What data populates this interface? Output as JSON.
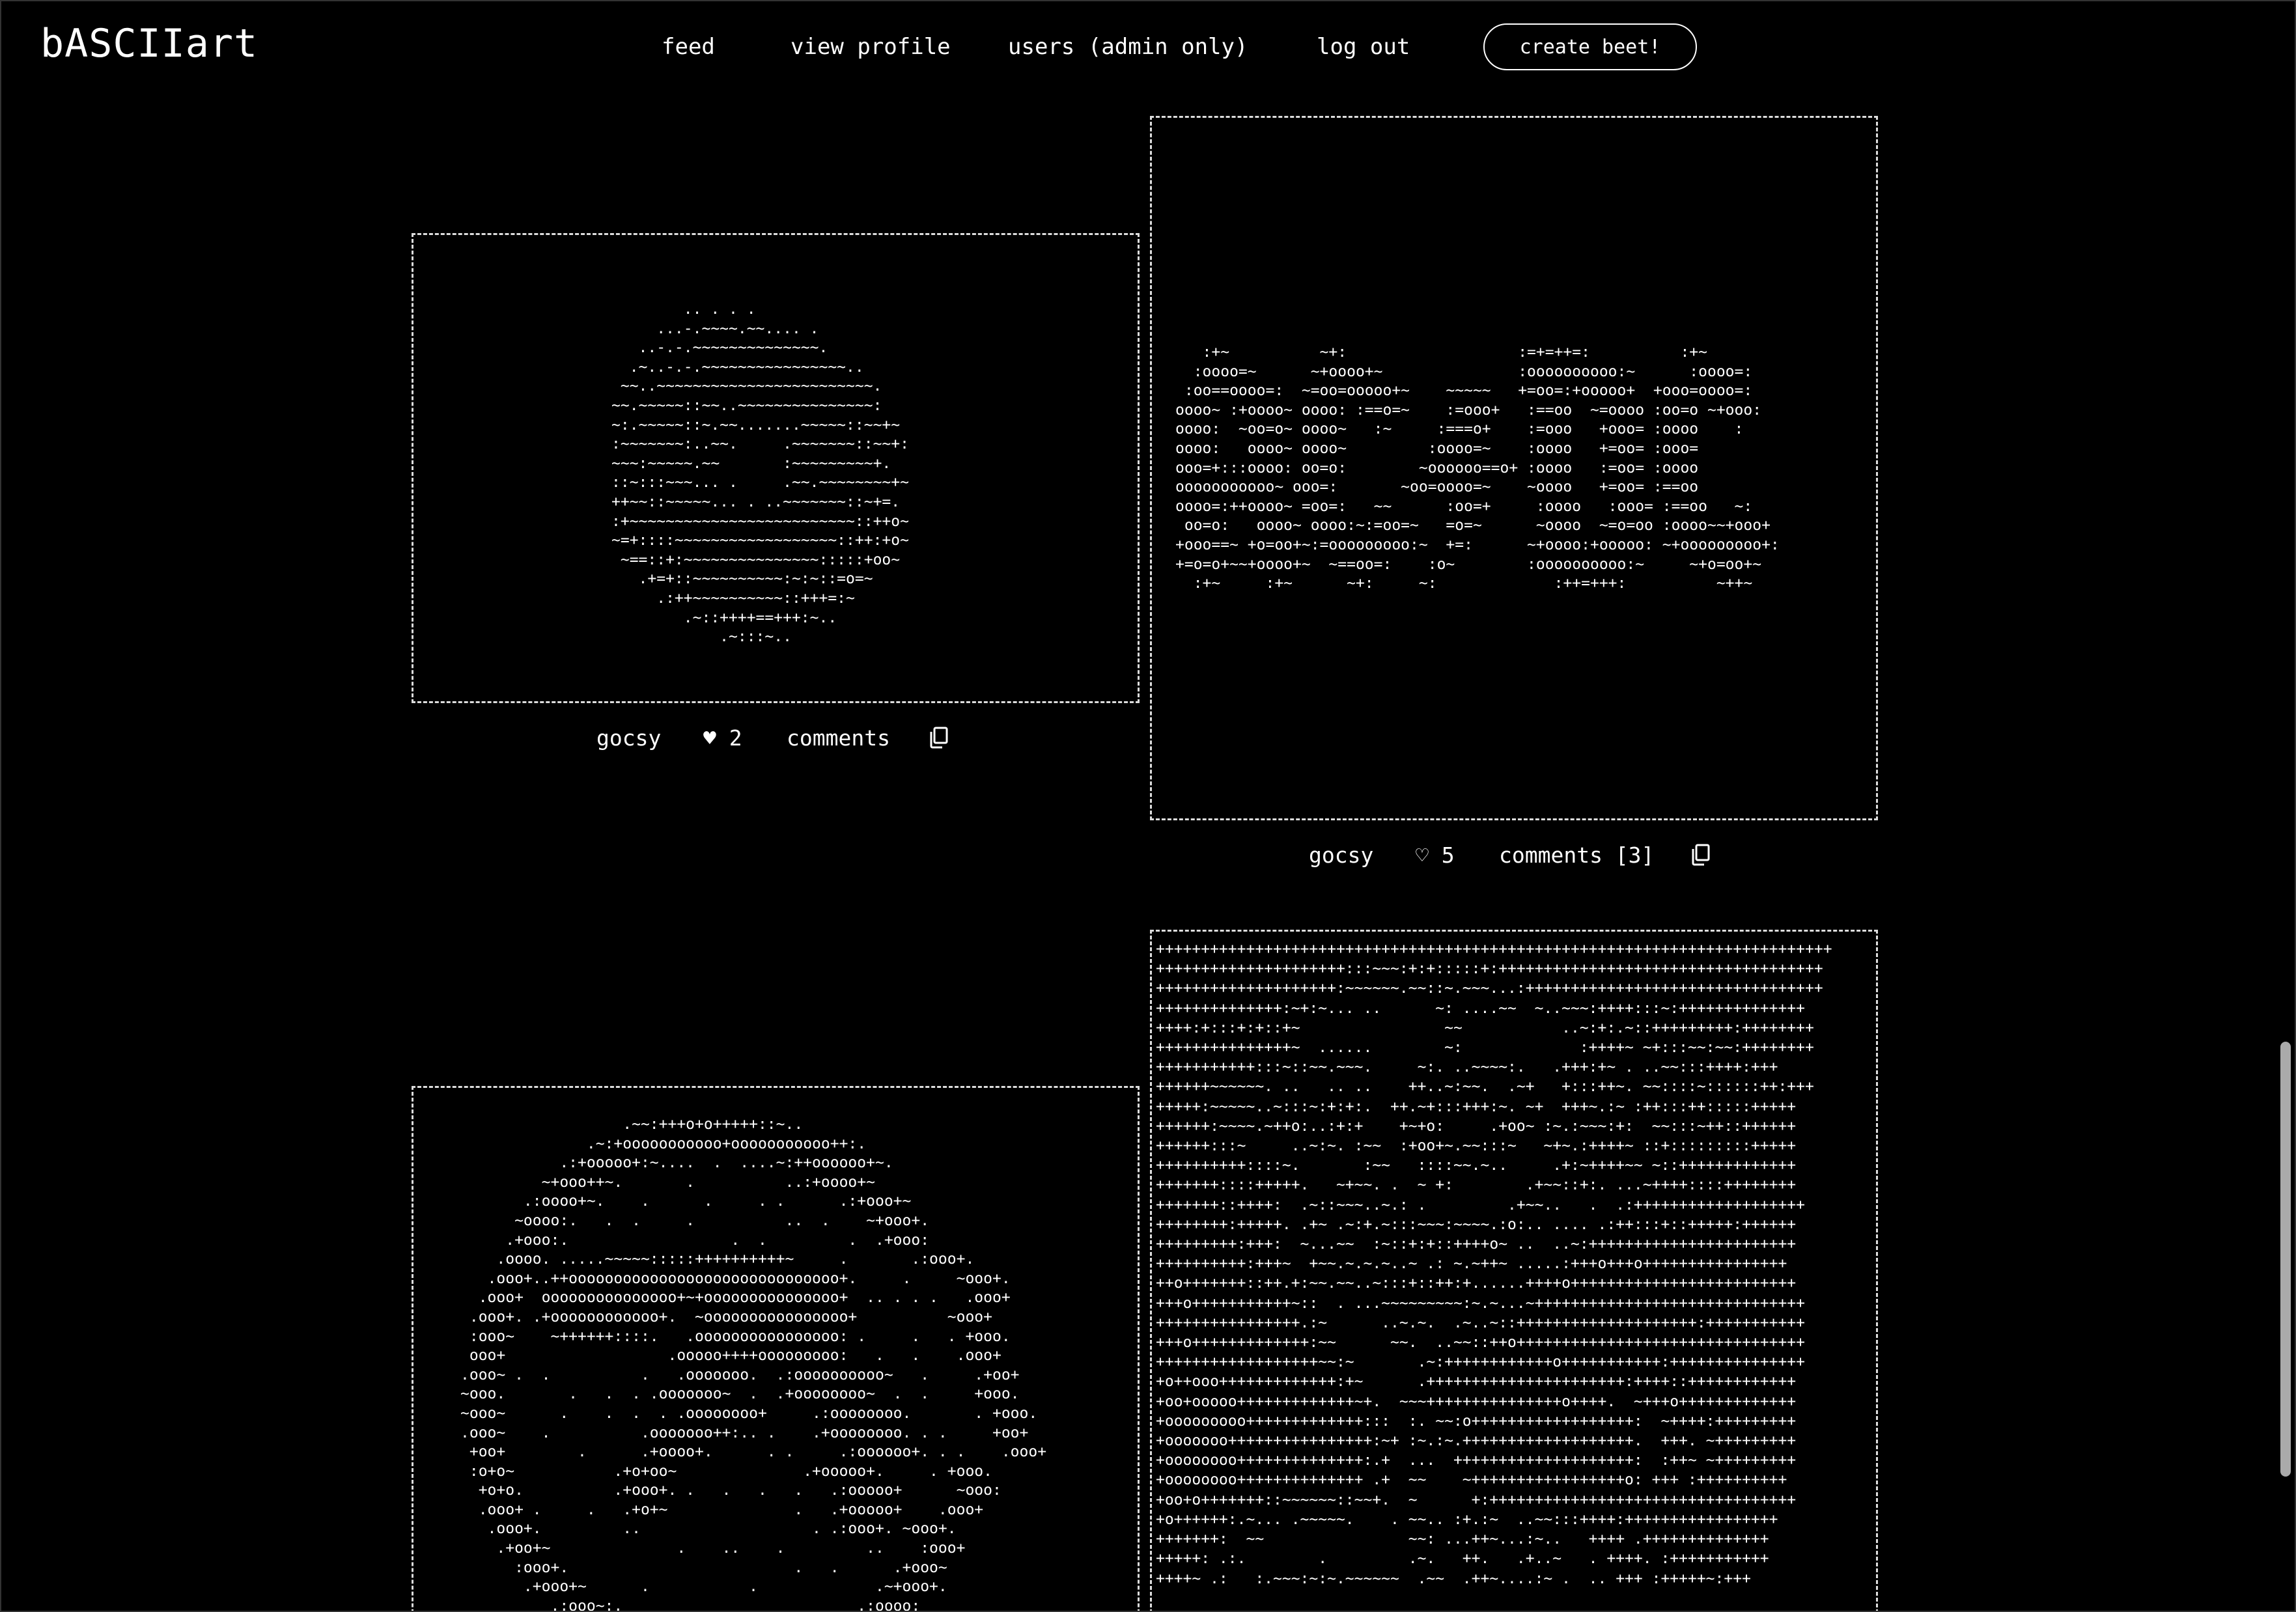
{
  "app": {
    "logo": "bASCIIart"
  },
  "nav": {
    "feed": "feed",
    "view_profile": "view profile",
    "users": "users (admin only)",
    "logout": "log out",
    "create": "create beet!"
  },
  "posts": [
    {
      "author": "gocsy",
      "likes": "♥ 2",
      "comments": "comments",
      "art": "        .. . . .\n     ...-.~~~~.~~.... .\n   ..-.-.~~~~~~~~~~~~~~.\n  .~..-.-.~~~~~~~~~~~~~~~~..\n ~~..~~~~~~~~~~~~~~~~~~~~~~~~.\n~~.~~~~~::~~..~~~~~~~~~~~~~~~:\n~:.~~~~~::~.~~.......~~~~~::~~+~\n:~~~~~~~:..~~.     .~~~~~~~::~~+:\n~~~:~~~~~.~~       :~~~~~~~~~+.\n::~:::~~~... .     .~~.~~~~~~~~+~\n++~~::~~~~~... . ..~~~~~~~::~+=.\n:+~~~~~~~~~~~~~~~~~~~~~~~~~::++o~\n~=+::::~~~~~~~~~~~~~~~~~~::++:+o~\n ~==::+:~~~~~~~~~~~~~~~:::::+oo~\n   .+=+::~~~~~~~~~~:~:~::=o=~\n     .:++~~~~~~~~~~::+++=:~\n        .~::++++==+++:~..\n            .~:::~.."
    },
    {
      "author": "gocsy",
      "likes": "♡ 5",
      "comments": "comments [3]",
      "art": "   :+~          ~+:                   :=+=++=:          :+~\n  :oooo=~      ~+oooo+~               :oooooooooo:~      :oooo=:\n :oo==oooo=:  ~=oo=ooooo+~    ~~~~~   +=oo=:+ooooo+  +ooo=oooo=:\noooo~ :+oooo~ oooo: :==o=~    :=ooo+   :==oo  ~=oooo :oo=o ~+ooo:\noooo:  ~oo=o~ oooo~   :~     :===o+    :=ooo   +ooo= :oooo    :\noooo:   oooo~ oooo~         :oooo=~    :oooo   +=oo= :ooo=\nooo=+:::oooo: oo=o:        ~oooooo==o+ :oooo   :=oo= :oooo\nooooooooooo~ ooo=:       ~oo=oooo=~    ~oooo   +=oo= :==oo\noooo=:++oooo~ =oo=:   ~~      :oo=+     :oooo   :ooo= :==oo   ~:\n oo=o:   oooo~ oooo:~:=oo=~   =o=~      ~oooo  ~=o=oo :oooo~~+ooo+\n+ooo==~ +o=oo+~:=ooooooooo:~  +=:      ~+oooo:+ooooo: ~+ooooooooo+:\n+=o=o+~~+oooo+~  ~==oo=:    :o~        :oooooooooo:~     ~+o=oo+~\n  :+~     :+~      ~+:     ~:             :++=+++:          ~++~"
    },
    {
      "author": "",
      "likes": "",
      "comments": "",
      "art": "                  .~~:+++o+o+++++::~..\n              .~:+ooooooooooo+ooooooooooo++:.\n           .:+ooooo+:~....  .  ....~:++oooooo+~.\n         ~+ooo++~.       .          ..:+oooo+~\n       .:oooo+~.    .      .     . .      .:+ooo+~\n      ~oooo:.   .  .     .          ..  .    ~+ooo+.\n     .+ooo:.                  .  .         .  .+ooo:\n    .oooo. .....~~~~~:::::++++++++++~     .       .:ooo+.\n   .ooo+..++oooooooooooooooooooooooooooooo+.     .     ~ooo+.\n  .ooo+  ooooooooooooooo+~+ooooooooooooooo+  .. . . .   .ooo+\n .ooo+. .+oooooooooooo+.  ~oooooooooooooooo+          ~ooo+\n :ooo~    ~++++++::::.   .oooooooooooooooo: .     .   . +ooo.\n ooo+                  .ooooo++++ooooooooo:   .   .    .ooo+\n.ooo~ .  .          .   .ooooooo.  .:oooooooooo~   .     .+oo+\n~ooo.       .   .  . .ooooooo~  .  .+oooooooo~  .  .     +ooo.\n~ooo~      .    .  .  . .oooooooo+     .:oooooooo.       . +ooo.\n.ooo~    .          .ooooooo++:.. .    .+oooooooo. . .     +oo+\n +oo+        .      .+oooo+.      . .     .:oooooo+. . .    .ooo+\n :o+o~           .+o+oo~              .+ooooo+.     . +ooo.\n  +o+o.          .+ooo+. .   .   .   .   .:ooooo+      ~ooo:\n  .ooo+ .     .   .+o+~              .   .+ooooo+    .ooo+\n   .ooo+.         ..                   . .:ooo+. ~ooo+.\n    .+oo+~              .    ..    .         ..    :ooo+\n      :ooo+.                         .   .      .+ooo~\n       .+ooo+~      .           .             .~+ooo+.\n          .:ooo~:.                          .:oooo:"
    },
    {
      "author": "",
      "likes": "",
      "comments": "",
      "art": "+++++++++++++++++++++++++++++++++++++++++++++++++++++++++++++++++++++++++++\n+++++++++++++++++++++:::~~~:+:+:::::+:++++++++++++++++++++++++++++++++++++\n++++++++++++++++++++:~~~~~~.~~::~.~~~...:+++++++++++++++++++++++++++++++++\n++++++++++++++:~+:~... ..      ~: ....~~  ~..~~~:++++:::~:++++++++++++++\n++++:+:::+:+::+~                ~~           ..~:+:.~::+++++++++:++++++++\n+++++++++++++++~  ......        ~:             :++++~ ~+:::~~:~~:++++++++\n+++++++++++:::~::~~.~~~.     ~:. ..~~~~:.   .+++:+~ . ..~~:::++++:+++\n++++++~~~~~~. ..   .. ..    ++..~:~~.  .~+   +:::++~. ~~::::~::::::++:+++\n+++++:~~~~~..~:::~:+:+:.  ++.~+:::+++:~. ~+  +++~.:~ :++:::++:::::+++++\n++++++:~~~~.~++o:..:+:+    +~+o:     .+oo~ :~.:~~~:+:  ~~:::~++::++++++\n++++++:::~     ..~:~. :~~  :+oo+~.~~:::~   ~+~.:++++~ ::+:::::::::+++++\n++++++++++::::~.       :~~   ::::~~.~..     .+:~++++~~ ~::+++++++++++++\n+++++++::::+++++.   ~+~~. .  ~ +:        .+~~::+:. ...~++++::::++++++++\n+++++++::++++:  .~::~~~..~.: .         .+~~..   .  .:+++++++++++++++++++\n++++++++:+++++. .+~ .~:+.~:::~~~:~~~~.:o:.. .... .:++:::+::+++++:++++++\n+++++++++:+++:  ~...~~  :~::+:+::++++o~ ..  ..~:+++++++++++++++++++++++\n++++++++++:+++~  +~~.~.~.~..~ .: ~.~++~ .....:+++o+++o++++++++++++++++\n++o+++++++::++.+:~~.~~..~:::+::++:+......++++o+++++++++++++++++++++++++\n+++o+++++++++++~::  . ...~~~~~~~~~:~.~...~++++++++++++++++++++++++++++++\n++++++++++++++++.:~      ..~.~.  .~..~::++++++++++++++++++++:+++++++++++\n+++o+++++++++++++:~~      ~~.  ..~~::++o++++++++++++++++++++++++++++++++\n++++++++++++++++++~~:~       .~:++++++++++++o+++++++++++:+++++++++++++++\n+o++ooo+++++++++++++:+~      .++++++++++++++++++++++:++++::++++++++++++\n+oo+ooooo+++++++++++++~+.  ~~~+++++++++++++++o++++.  ~+++o+++++++++++++\n+ooooooooo+++++++++++++:::  :. ~~:o++++++++++++++++++:  ~++++:+++++++++\n+ooooooo++++++++++++++++:~+ :~.:~.+++++++++++++++++++.  +++. ~+++++++++\n+oooooooo++++++++++++++:.+  ...  ++++++++++++++++++++:  :++~ ~+++++++++\n+oooooooo++++++++++++++ .+  ~~    ~+++++++++++++++++o: +++ :++++++++++\n+oo+o+++++++::~~~~~~::~~+.  ~      +:++++++++++++++++++++++++++++++++++\n+o++++++:.~... .~~~~~.    . ~~.. :+.:~  ..~~:::++++:+++++++++++++++++\n+++++++:  ~~                ~~: ...++~...:~..   ++++ .++++++++++++++\n+++++: .:.        .         .~.   ++.   .+..~   . ++++. :+++++++++++\n++++~ .:   :.~~~:~:~.~~~~~~  .~~  .++~....:~ .  .. +++ :+++++~:+++"
    }
  ]
}
